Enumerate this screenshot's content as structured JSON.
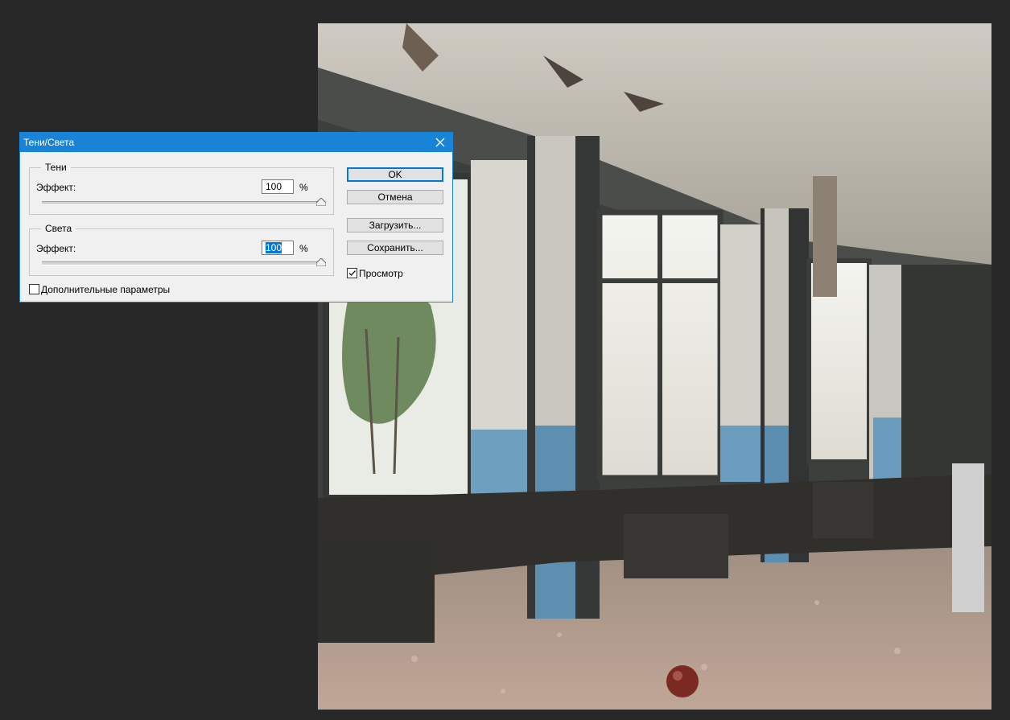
{
  "dialog": {
    "title": "Тени/Света",
    "shadows": {
      "legend": "Тени",
      "effect_label": "Эффект:",
      "value": "100",
      "unit": "%",
      "level": 1.0
    },
    "highlights": {
      "legend": "Света",
      "effect_label": "Эффект:",
      "value": "100",
      "unit": "%",
      "level": 1.0
    },
    "buttons": {
      "ok": "OK",
      "cancel": "Отмена",
      "load": "Загрузить...",
      "save": "Сохранить..."
    },
    "preview": {
      "label": "Просмотр",
      "checked": true
    },
    "advanced": {
      "label": "Дополнительные параметры",
      "checked": false
    }
  },
  "colors": {
    "accent": "#1883d7",
    "workspace": "#282828",
    "dialog_bg": "#f0f0f0",
    "selection": "#0078d7"
  },
  "icons": {
    "close": "close-icon",
    "slider_thumb": "slider-thumb-icon",
    "checkmark": "checkmark-icon"
  }
}
